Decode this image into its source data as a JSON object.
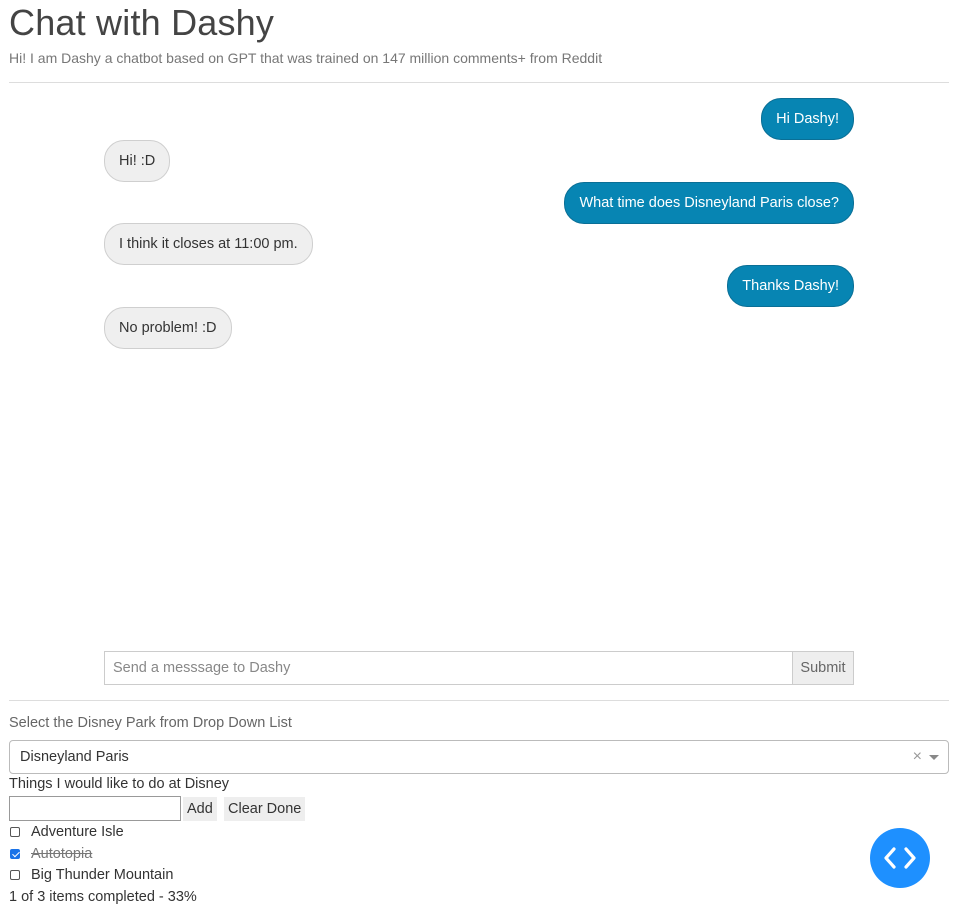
{
  "header": {
    "title": "Chat with Dashy",
    "subtitle": "Hi! I am Dashy a chatbot based on GPT that was trained on 147 million comments+ from Reddit"
  },
  "chat": {
    "messages": [
      {
        "sender": "user",
        "text": "Hi Dashy!"
      },
      {
        "sender": "bot",
        "text": "Hi! :D"
      },
      {
        "sender": "user",
        "text": "What time does Disneyland Paris close?"
      },
      {
        "sender": "bot",
        "text": "I think it closes at 11:00 pm."
      },
      {
        "sender": "user",
        "text": "Thanks Dashy!"
      },
      {
        "sender": "bot",
        "text": "No problem! :D"
      }
    ],
    "input_placeholder": "Send a messsage to Dashy",
    "input_value": "",
    "submit_label": "Submit"
  },
  "park_select": {
    "label": "Select the Disney Park from Drop Down List",
    "selected": "Disneyland Paris",
    "clear_symbol": "×"
  },
  "todo": {
    "title": "Things I would like to do at Disney",
    "input_value": "",
    "add_label": "Add",
    "clear_label": "Clear Done",
    "items": [
      {
        "label": "Adventure Isle",
        "done": false
      },
      {
        "label": "Autotopia",
        "done": true
      },
      {
        "label": "Big Thunder Mountain",
        "done": false
      }
    ],
    "status": "1 of 3 items completed - 33%"
  },
  "fab": {
    "icon": "code-brackets-icon",
    "color": "#1e90ff"
  },
  "colors": {
    "user_bubble": "#0785b3",
    "bot_bubble": "#efefef"
  }
}
